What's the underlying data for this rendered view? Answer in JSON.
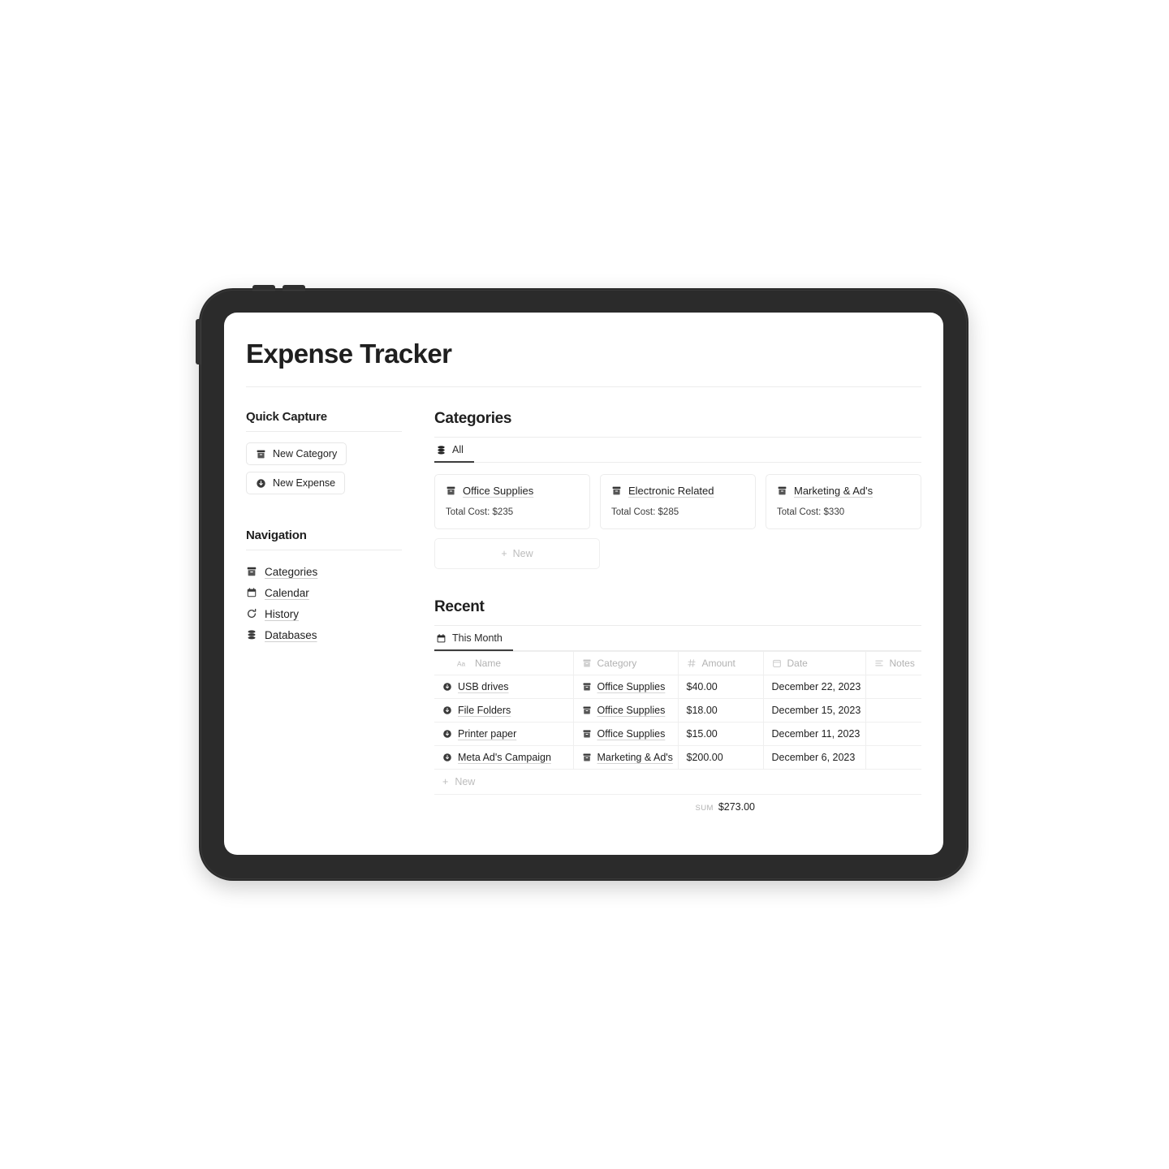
{
  "app": {
    "title": "Expense Tracker"
  },
  "sidebar": {
    "quick_capture": {
      "heading": "Quick Capture",
      "buttons": [
        {
          "label": "New Category",
          "icon": "archive-box-icon"
        },
        {
          "label": "New Expense",
          "icon": "expense-circle-icon"
        }
      ]
    },
    "navigation": {
      "heading": "Navigation",
      "items": [
        {
          "label": "Categories",
          "icon": "archive-box-icon"
        },
        {
          "label": "Calendar",
          "icon": "calendar-icon"
        },
        {
          "label": "History",
          "icon": "history-icon"
        },
        {
          "label": "Databases",
          "icon": "database-stack-icon"
        }
      ]
    }
  },
  "categories_section": {
    "heading": "Categories",
    "tab": {
      "label": "All",
      "icon": "database-stack-icon",
      "active": true
    },
    "cost_label_prefix": "Total Cost: ",
    "cards": [
      {
        "name": "Office Supplies",
        "total_cost": "$235",
        "cost_text": "Total Cost: $235",
        "icon": "archive-box-icon"
      },
      {
        "name": "Electronic Related",
        "total_cost": "$285",
        "cost_text": "Total Cost: $285",
        "icon": "archive-box-icon"
      },
      {
        "name": "Marketing & Ad's",
        "total_cost": "$330",
        "cost_text": "Total Cost: $330",
        "icon": "archive-box-icon"
      }
    ],
    "new_card": {
      "label": "New",
      "plus": "+"
    }
  },
  "recent_section": {
    "heading": "Recent",
    "tab": {
      "label": "This Month",
      "icon": "calendar-icon",
      "active": true
    },
    "columns": [
      {
        "label": "Name",
        "icon": "text-aa-icon"
      },
      {
        "label": "Category",
        "icon": "archive-box-icon"
      },
      {
        "label": "Amount",
        "icon": "number-hash-icon"
      },
      {
        "label": "Date",
        "icon": "calendar-outline-icon"
      },
      {
        "label": "Notes",
        "icon": "text-lines-icon"
      }
    ],
    "rows": [
      {
        "name": "USB drives",
        "category": "Office Supplies",
        "amount": "$40.00",
        "date": "December 22, 2023",
        "notes": ""
      },
      {
        "name": "File Folders",
        "category": "Office Supplies",
        "amount": "$18.00",
        "date": "December 15, 2023",
        "notes": ""
      },
      {
        "name": "Printer paper",
        "category": "Office Supplies",
        "amount": "$15.00",
        "date": "December 11, 2023",
        "notes": ""
      },
      {
        "name": "Meta Ad's Campaign",
        "category": "Marketing & Ad's",
        "amount": "$200.00",
        "date": "December 6, 2023",
        "notes": ""
      }
    ],
    "new_row": {
      "label": "New",
      "plus": "+"
    },
    "summary": {
      "label": "SUM",
      "value": "$273.00"
    }
  },
  "colors": {
    "device_frame": "#2b2b2b",
    "screen_bg": "#ffffff",
    "text_primary": "#1f1f1f",
    "text_muted": "#b2b2b2",
    "divider": "#ececec",
    "tab_underline": "#3d3d3d"
  }
}
